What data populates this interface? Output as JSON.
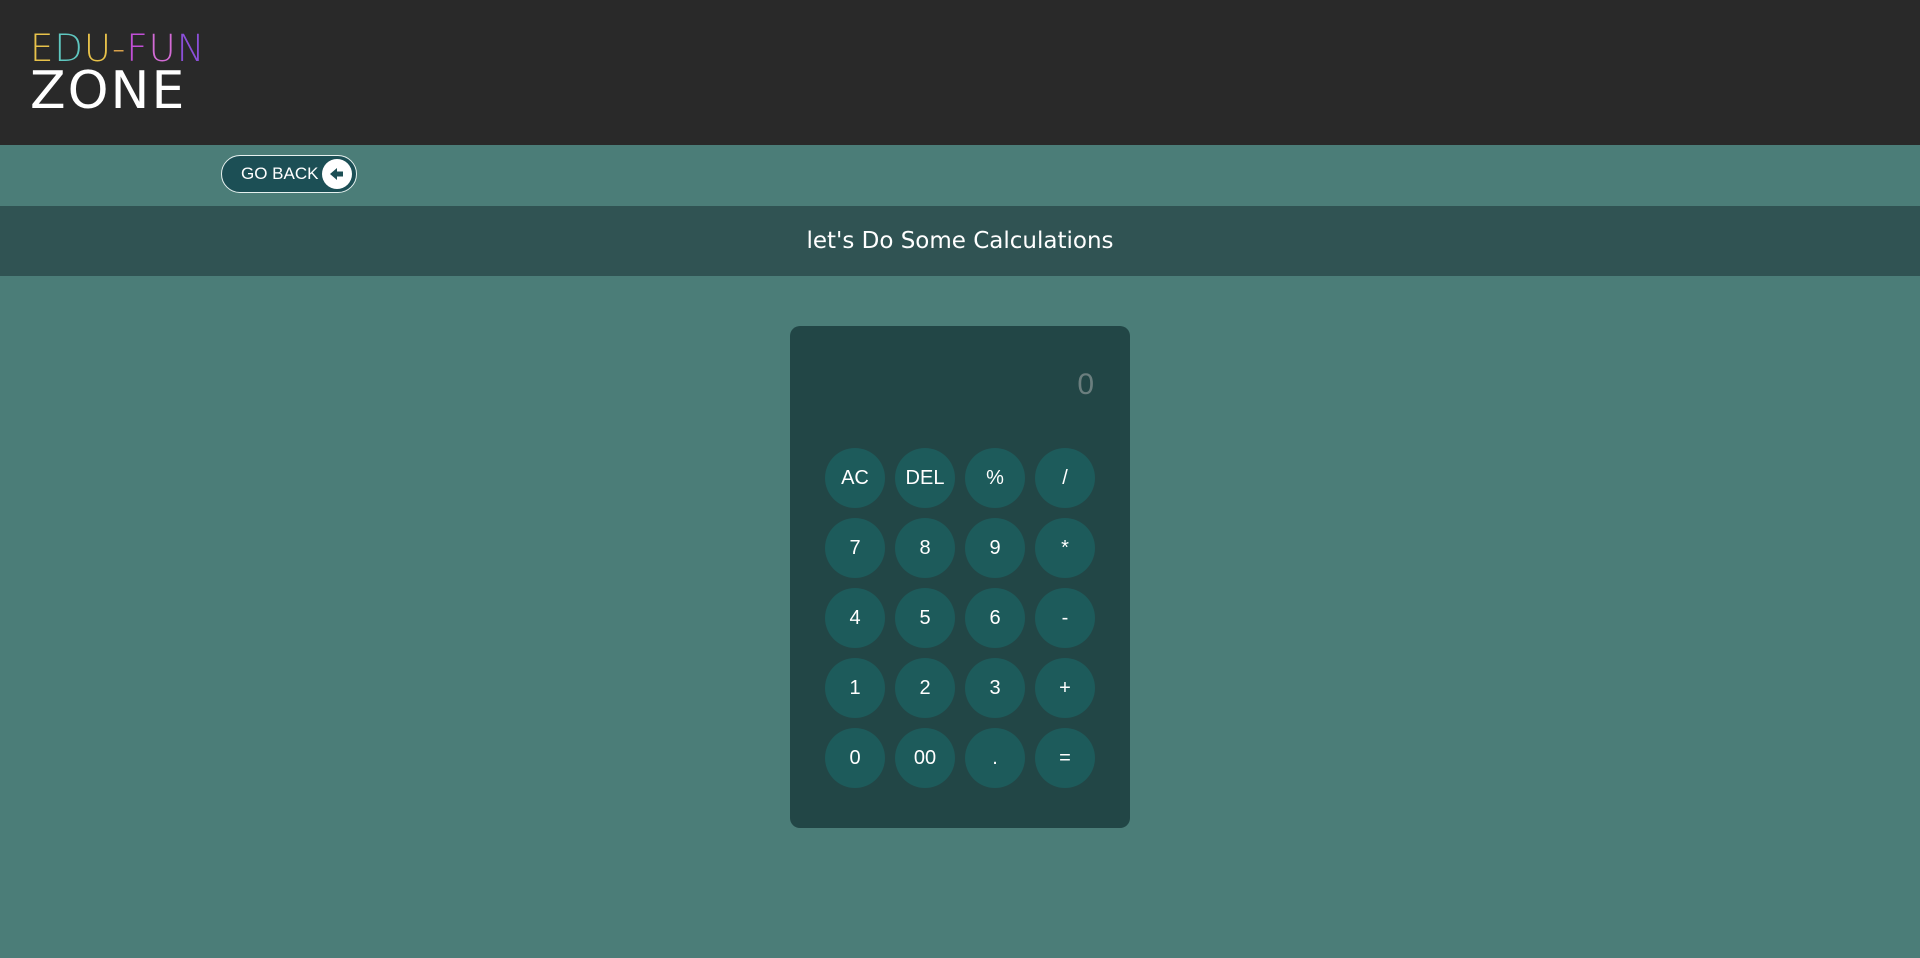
{
  "header": {
    "logo": {
      "top_segments": [
        {
          "text": "E",
          "color": "#e8c24a"
        },
        {
          "text": "D",
          "color": "#5fc7c0"
        },
        {
          "text": "U",
          "color": "#e8c24a"
        },
        {
          "text": "-",
          "color": "#d9a14a"
        },
        {
          "text": "F",
          "color": "#c14fd6"
        },
        {
          "text": "U",
          "color": "#d36bd5"
        },
        {
          "text": "N",
          "color": "#8b4fd8"
        }
      ],
      "bottom_text": "ZONE",
      "bottom_color": "#ffffff"
    }
  },
  "nav": {
    "go_back_label": "GO BACK",
    "go_back_icon": "arrow-left-circle-icon"
  },
  "title": "let's Do Some Calculations",
  "calculator": {
    "display_value": "0",
    "keys": [
      [
        "AC",
        "DEL",
        "%",
        "/"
      ],
      [
        "7",
        "8",
        "9",
        "*"
      ],
      [
        "4",
        "5",
        "6",
        "-"
      ],
      [
        "1",
        "2",
        "3",
        "+"
      ],
      [
        "0",
        "00",
        ".",
        "="
      ]
    ]
  },
  "colors": {
    "header_bg": "#292929",
    "page_bg": "#4b7d78",
    "title_bar_bg": "#305353",
    "calculator_bg": "#224646",
    "key_bg": "#1d5b5b"
  }
}
